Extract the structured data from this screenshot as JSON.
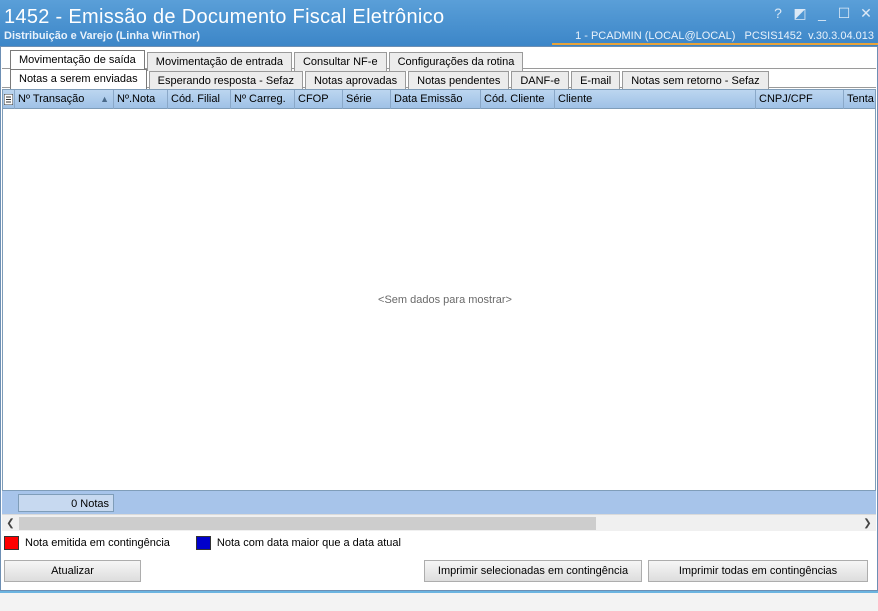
{
  "window": {
    "title": "1452 - Emissão de Documento Fiscal Eletrônico",
    "subtitle": "Distribuição e Varejo (Linha WinThor)",
    "user_info": "1 - PCADMIN (LOCAL@LOCAL)   PCSIS1452  v.30.3.04.013",
    "controls": [
      "?",
      "◩",
      "_",
      "☐",
      "✕"
    ]
  },
  "main_tabs": [
    {
      "label": "Movimentação de saída",
      "active": true
    },
    {
      "label": "Movimentação de entrada",
      "active": false
    },
    {
      "label": "Consultar NF-e",
      "active": false
    },
    {
      "label": "Configurações da rotina",
      "active": false
    }
  ],
  "sub_tabs": [
    {
      "label": "Notas a serem enviadas",
      "active": true
    },
    {
      "label": "Esperando resposta - Sefaz",
      "active": false
    },
    {
      "label": "Notas aprovadas",
      "active": false
    },
    {
      "label": "Notas pendentes",
      "active": false
    },
    {
      "label": "DANF-e",
      "active": false
    },
    {
      "label": "E-mail",
      "active": false
    },
    {
      "label": "Notas sem retorno - Sefaz",
      "active": false
    }
  ],
  "grid": {
    "columns": [
      "Nº Transação",
      "Nº.Nota",
      "Cód. Filial",
      "Nº Carreg.",
      "CFOP",
      "Série",
      "Data Emissão",
      "Cód. Cliente",
      "Cliente",
      "CNPJ/CPF",
      "Tenta"
    ],
    "sort_indicator": "▲",
    "empty_message": "<Sem dados para mostrar>",
    "count_label": "0 Notas"
  },
  "legend": [
    {
      "color": "#ff0000",
      "label": "Nota emitida em contingência"
    },
    {
      "color": "#0000cc",
      "label": "Nota com data maior que a data atual"
    }
  ],
  "buttons": {
    "refresh": "Atualizar",
    "print_selected": "Imprimir selecionadas em contingência",
    "print_all": "Imprimir todas em contingências"
  },
  "colors": {
    "titlebar": "#4a93d2",
    "grid_header": "#aecbec",
    "accent_line": "#e8a33a"
  }
}
